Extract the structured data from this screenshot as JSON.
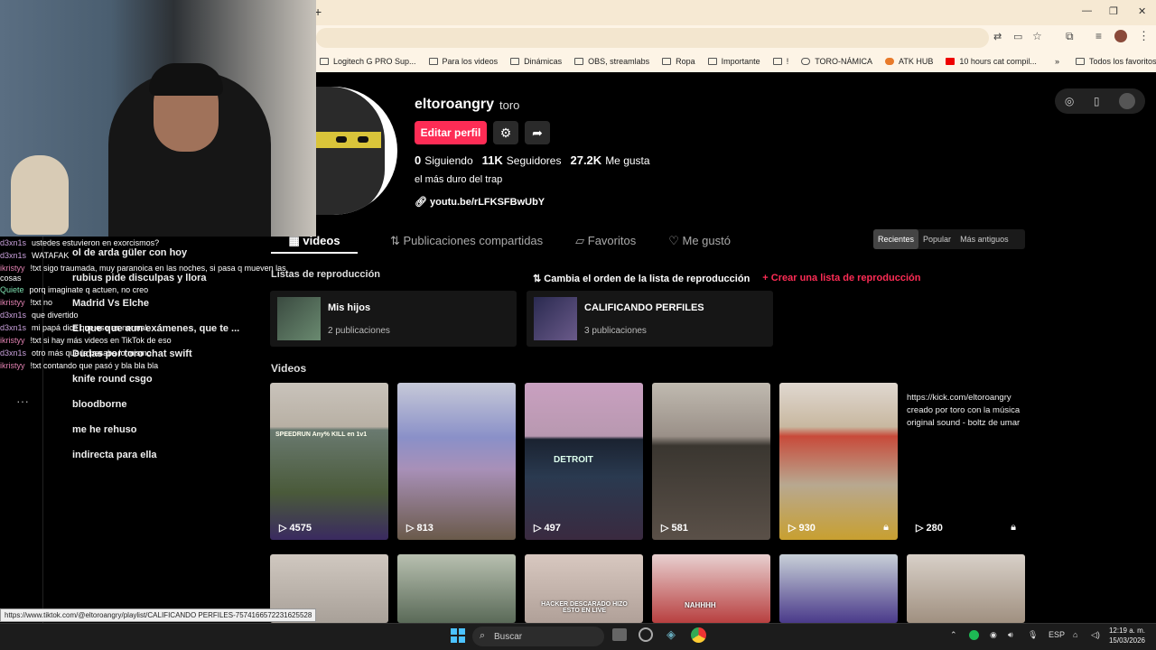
{
  "browser": {
    "new_tab": "+",
    "bookmarks": [
      "Logitech G PRO Sup...",
      "Para los videos",
      "Dinámicas",
      "OBS, streamlabs",
      "Ropa",
      "Importante",
      "!",
      "TORO-NÁMICA",
      "ATK HUB",
      "10 hours cat compil..."
    ],
    "all_favorites": "Todos los favoritos",
    "more": "»"
  },
  "profile": {
    "username": "eltoroangry",
    "nickname": "toro",
    "edit_button": "Editar perfil",
    "following_count": "0",
    "following_label": "Siguiendo",
    "followers_count": "11K",
    "followers_label": "Seguidores",
    "likes_count": "27.2K",
    "likes_label": "Me gusta",
    "bio": "el más duro del trap",
    "link": "youtu.be/rLFKSFBwUbY"
  },
  "tabs": [
    "videos",
    "Publicaciones compartidas",
    "Favoritos",
    "Me gustó"
  ],
  "sort": [
    "Recientes",
    "Popular",
    "Más antiguos"
  ],
  "playlists": {
    "title": "Listas de reproducción",
    "reorder": "Cambia el orden de la lista de reproducción",
    "create": "Crear una lista de reproducción",
    "items": [
      {
        "name": "Mis hijos",
        "count": "2 publicaciones"
      },
      {
        "name": "CALIFICANDO PERFILES",
        "count": "3 publicaciones"
      }
    ]
  },
  "videos": {
    "title": "Videos",
    "items": [
      {
        "views": "4575",
        "caption": "SPEEDRUN Any% KILL en 1v1"
      },
      {
        "views": "813"
      },
      {
        "views": "497",
        "caption": "DETROIT"
      },
      {
        "views": "581"
      },
      {
        "views": "930"
      },
      {
        "views": "280",
        "alt_text": "https://kick.com/eltoroangry creado por toro con la música original sound - boltz de umar"
      }
    ],
    "row2_captions": [
      "",
      "",
      "HACKER DESCARADO HIZO ESTO EN LIVE",
      "NAHHHH",
      "",
      ""
    ]
  },
  "sidebar_playlists": [
    "ol de arda güler con hoy",
    "rubius pide disculpas y llora",
    "Madrid Vs Elche",
    "El que que aun exámenes, que te ...",
    "Dudas por toro chat swift",
    "knife round csgo",
    "bloodborne",
    "me he rehuso",
    "indirecta para ella"
  ],
  "chat": [
    {
      "user": "d3xn1s",
      "msg": "ustedes estuvieron en exorcismos?"
    },
    {
      "user": "d3xn1s",
      "msg": "WATAFAK"
    },
    {
      "user": "ikristyy",
      "msg": "!txt sigo traumada, muy paranoica en las noches, si pasa q mueven las cosas"
    },
    {
      "user": "Quiete",
      "msg": "porq imaginate q actuen, no creo"
    },
    {
      "user": "ikristyy",
      "msg": "!txt no"
    },
    {
      "user": "d3xn1s",
      "msg": "que divertido"
    },
    {
      "user": "d3xn1s",
      "msg": "mi papá dice que eso es normal"
    },
    {
      "user": "ikristyy",
      "msg": "!txt si hay más videos en TikTok de eso"
    },
    {
      "user": "d3xn1s",
      "msg": "otro más que le pasaba lo mismo"
    },
    {
      "user": "ikristyy",
      "msg": "!txt contando que pasó y bla bla bla"
    }
  ],
  "status_url": "https://www.tiktok.com/@eltoroangry/playlist/CALIFICANDO PERFILES-7574166572231625528",
  "taskbar": {
    "search": "Buscar",
    "lang": "ESP",
    "time": "12:19 a. m.",
    "date": "15/03/2026"
  },
  "colors": {
    "accent": "#fe2c55",
    "chrome": "#fdf4e6"
  }
}
